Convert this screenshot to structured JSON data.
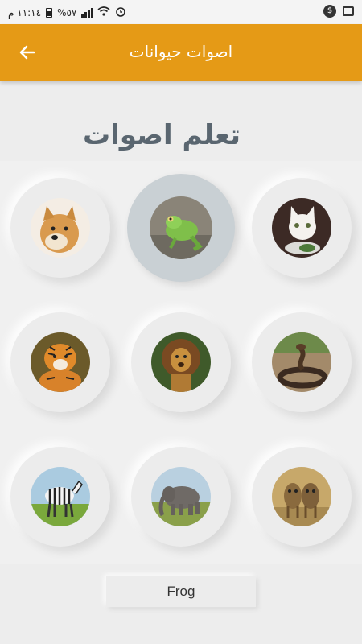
{
  "status_bar": {
    "time": "١١:١٤ م",
    "battery": "%٥٧"
  },
  "app_bar": {
    "title": "اصوات حيوانات"
  },
  "section_title": "تعلم اصوات",
  "animals": [
    {
      "name": "dog",
      "icon": "dog-photo"
    },
    {
      "name": "frog",
      "icon": "frog-photo",
      "selected": true
    },
    {
      "name": "cat",
      "icon": "cat-photo"
    },
    {
      "name": "tiger",
      "icon": "tiger-photo"
    },
    {
      "name": "lion",
      "icon": "lion-photo"
    },
    {
      "name": "snake",
      "icon": "snake-photo"
    },
    {
      "name": "zebra",
      "icon": "zebra-photo"
    },
    {
      "name": "elephant",
      "icon": "elephant-photo"
    },
    {
      "name": "hyena",
      "icon": "hyena-photo"
    }
  ],
  "selected_animal_label": "Frog",
  "colors": {
    "app_bar": "#e59a16",
    "selected_tile": "#c9d0d4",
    "title_text": "#5a6670"
  }
}
